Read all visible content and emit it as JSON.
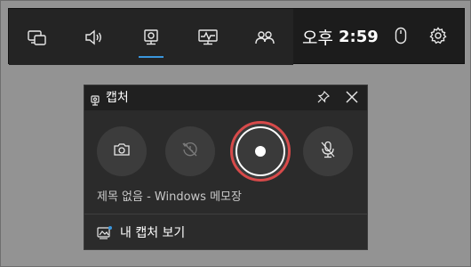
{
  "topbar": {
    "buttons": [
      {
        "name": "widget-menu-icon"
      },
      {
        "name": "audio-icon"
      },
      {
        "name": "capture-icon",
        "active": true
      },
      {
        "name": "performance-icon"
      },
      {
        "name": "social-icon"
      }
    ],
    "clock": {
      "ampm": "오후",
      "time": "2:59"
    },
    "right_buttons": [
      {
        "name": "mouse-icon"
      },
      {
        "name": "settings-gear-icon"
      }
    ]
  },
  "capture": {
    "title": "캡처",
    "title_icon": "webcam-icon",
    "pin_icon": "pin-icon",
    "close_icon": "close-icon",
    "actions": [
      {
        "name": "screenshot-button",
        "icon": "camera-icon",
        "enabled": true
      },
      {
        "name": "record-last-button",
        "icon": "rewind-clock-icon",
        "enabled": false
      },
      {
        "name": "start-recording-button",
        "icon": "record-dot-icon",
        "enabled": true
      },
      {
        "name": "mic-toggle-button",
        "icon": "mic-off-icon",
        "enabled": true
      }
    ],
    "target_window": "제목 없음 - Windows 메모장",
    "show_captures_label": "내 캡처 보기",
    "show_captures_icon": "gallery-icon"
  },
  "colors": {
    "accent_blue": "#3a96dd",
    "record_red": "#d74a4a",
    "bar_background": "#1c1c1c",
    "panel_background": "#2b2b2b"
  }
}
